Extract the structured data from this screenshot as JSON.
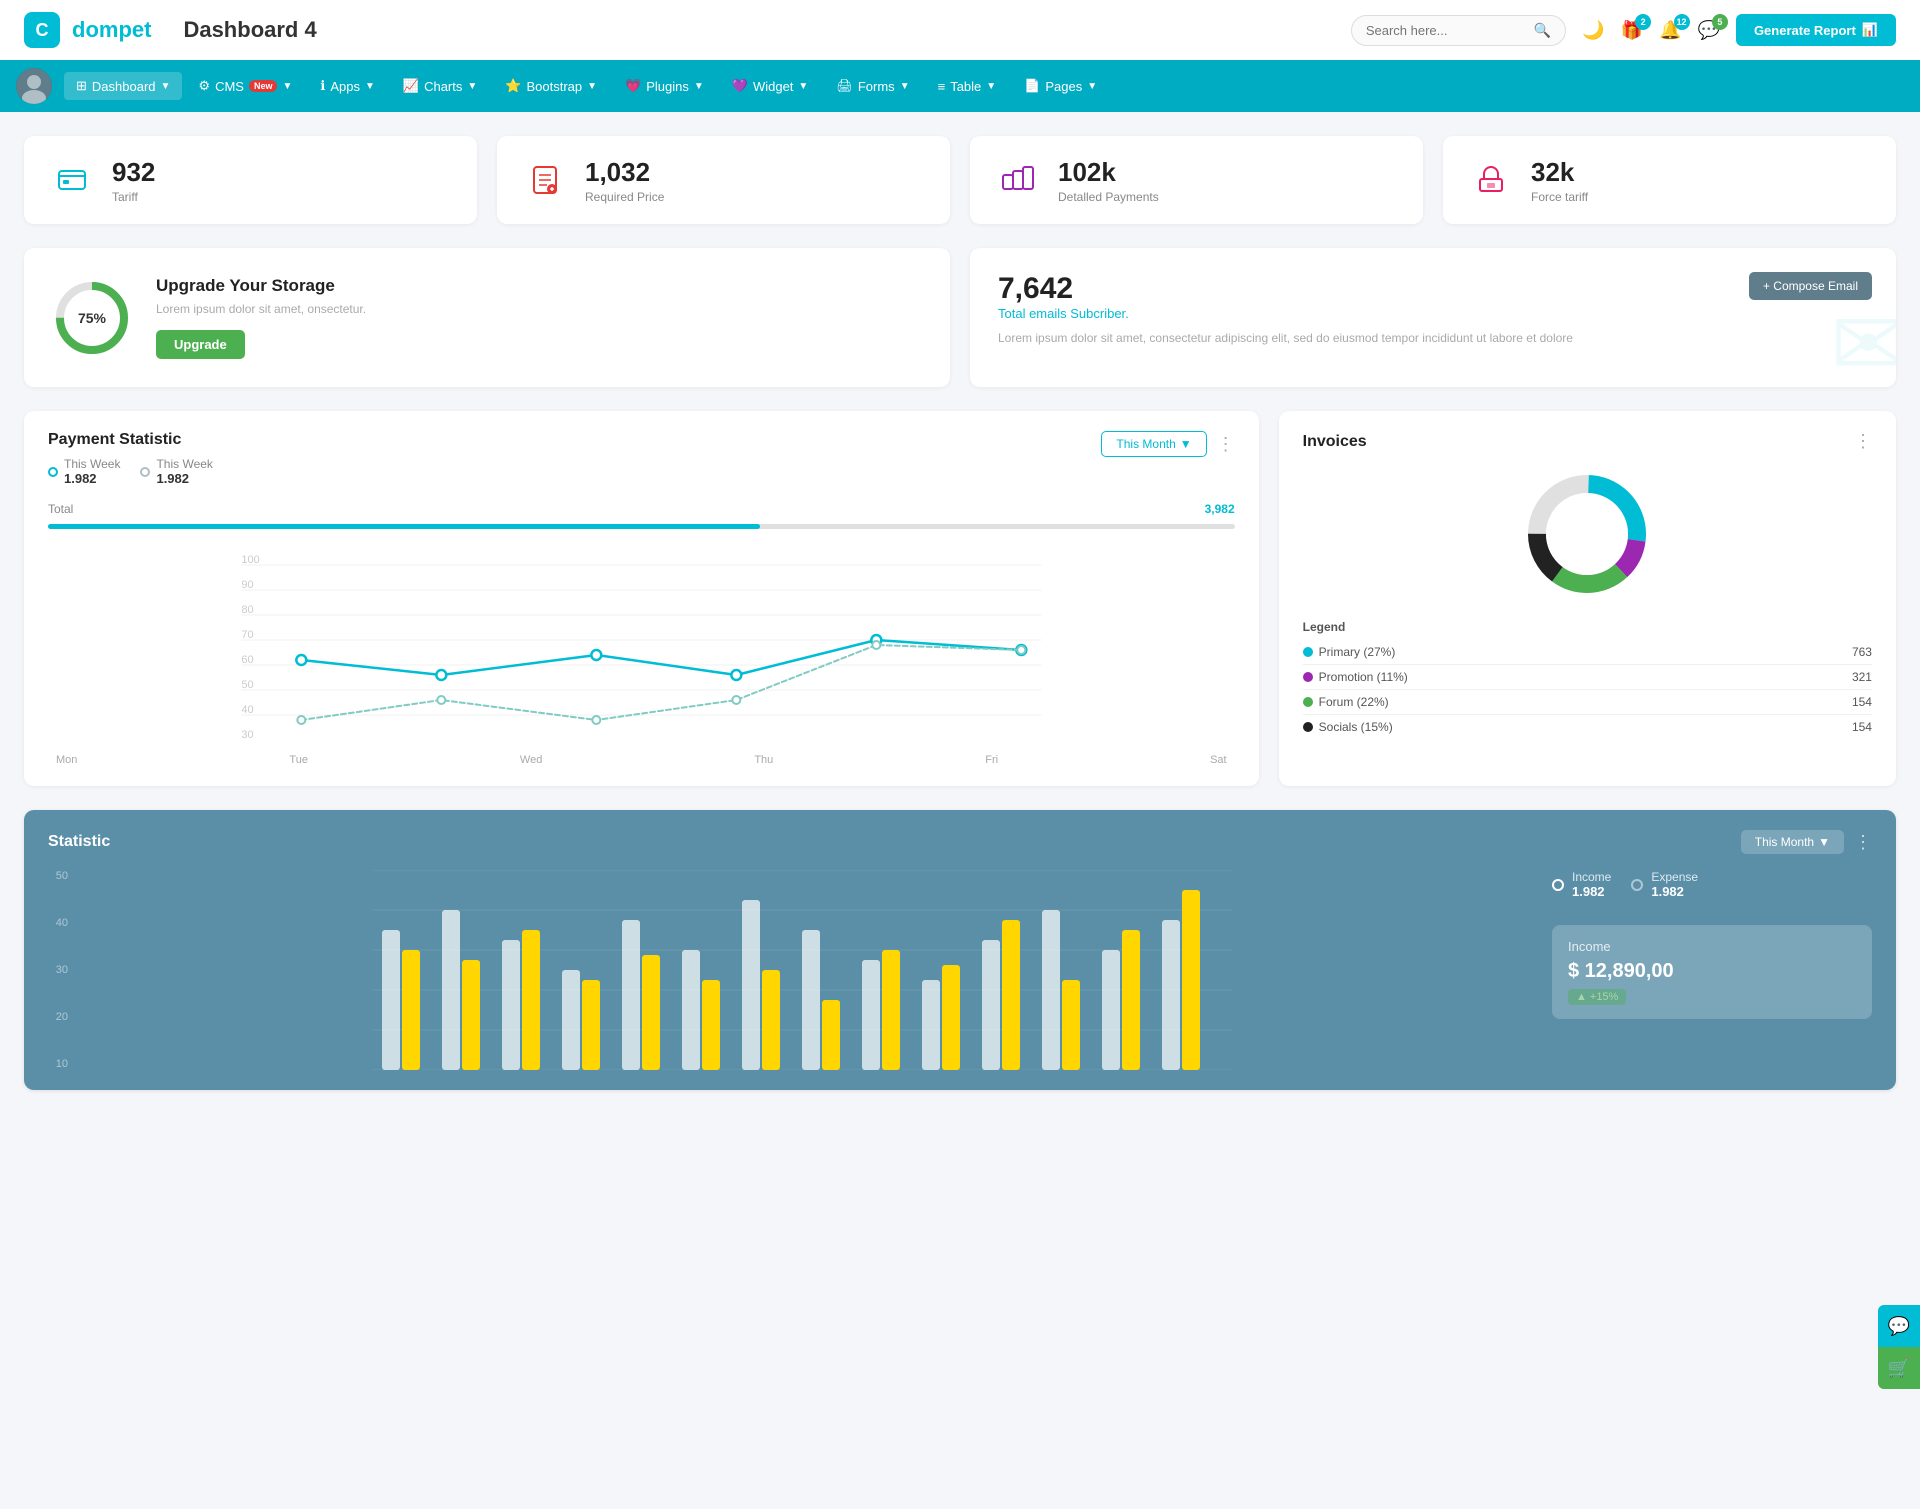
{
  "header": {
    "logo_icon": "C",
    "logo_text": "dompet",
    "page_title": "Dashboard 4",
    "search_placeholder": "Search here...",
    "generate_btn_label": "Generate Report",
    "icons": {
      "gift_badge": "2",
      "bell_badge": "12",
      "chat_badge": "5"
    }
  },
  "navbar": {
    "items": [
      {
        "id": "dashboard",
        "label": "Dashboard",
        "icon": "⊞",
        "active": true,
        "has_arrow": true
      },
      {
        "id": "cms",
        "label": "CMS",
        "icon": "⚙",
        "active": false,
        "has_arrow": true,
        "badge": "New"
      },
      {
        "id": "apps",
        "label": "Apps",
        "icon": "ℹ",
        "active": false,
        "has_arrow": true
      },
      {
        "id": "charts",
        "label": "Charts",
        "icon": "📈",
        "active": false,
        "has_arrow": true
      },
      {
        "id": "bootstrap",
        "label": "Bootstrap",
        "icon": "⭐",
        "active": false,
        "has_arrow": true
      },
      {
        "id": "plugins",
        "label": "Plugins",
        "icon": "💗",
        "active": false,
        "has_arrow": true
      },
      {
        "id": "widget",
        "label": "Widget",
        "icon": "💜",
        "active": false,
        "has_arrow": true
      },
      {
        "id": "forms",
        "label": "Forms",
        "icon": "🖨",
        "active": false,
        "has_arrow": true
      },
      {
        "id": "table",
        "label": "Table",
        "icon": "≡",
        "active": false,
        "has_arrow": true
      },
      {
        "id": "pages",
        "label": "Pages",
        "icon": "📄",
        "active": false,
        "has_arrow": true
      }
    ]
  },
  "stat_cards": [
    {
      "id": "tariff",
      "value": "932",
      "label": "Tariff",
      "icon": "💼",
      "color": "teal"
    },
    {
      "id": "required_price",
      "value": "1,032",
      "label": "Required Price",
      "icon": "📋",
      "color": "red"
    },
    {
      "id": "detailed_payments",
      "value": "102k",
      "label": "Detalled Payments",
      "icon": "🏪",
      "color": "purple"
    },
    {
      "id": "force_tariff",
      "value": "32k",
      "label": "Force tariff",
      "icon": "🏦",
      "color": "pink"
    }
  ],
  "storage": {
    "percent": "75%",
    "title": "Upgrade Your Storage",
    "description": "Lorem ipsum dolor sit amet, onsectetur.",
    "btn_label": "Upgrade",
    "percent_num": 75
  },
  "email": {
    "count": "7,642",
    "subtitle": "Total emails Subcriber.",
    "description": "Lorem ipsum dolor sit amet, consectetur adipiscing elit, sed do eiusmod tempor incididunt ut labore et dolore",
    "compose_btn": "+ Compose Email"
  },
  "payment_statistic": {
    "title": "Payment Statistic",
    "legend": [
      {
        "label": "This Week",
        "value": "1.982",
        "color": "#00bcd4"
      },
      {
        "label": "This Week",
        "value": "1.982",
        "color": "#b0bec5"
      }
    ],
    "month_btn": "This Month",
    "total_label": "Total",
    "total_value": "3,982",
    "x_labels": [
      "Mon",
      "Tue",
      "Wed",
      "Thu",
      "Fri",
      "Sat"
    ],
    "y_labels": [
      "100",
      "90",
      "80",
      "70",
      "60",
      "50",
      "40",
      "30"
    ],
    "line1": "60,145 70,165 175,130 355,110 490,145 495,145 630,95 765,110",
    "line2": "60,175 70,155 175,160 355,175 490,160 495,160 630,100 765,105"
  },
  "invoices": {
    "title": "Invoices",
    "legend_title": "Legend",
    "items": [
      {
        "label": "Primary (27%)",
        "color": "#00bcd4",
        "value": "763"
      },
      {
        "label": "Promotion (11%)",
        "color": "#9c27b0",
        "value": "321"
      },
      {
        "label": "Forum (22%)",
        "color": "#4caf50",
        "value": "154"
      },
      {
        "label": "Socials (15%)",
        "color": "#222",
        "value": "154"
      }
    ]
  },
  "statistic": {
    "title": "Statistic",
    "month_btn": "This Month",
    "y_labels": [
      "50",
      "40",
      "30",
      "20",
      "10"
    ],
    "income": {
      "label": "Income",
      "value": "1.982"
    },
    "expense": {
      "label": "Expense",
      "value": "1.982"
    },
    "income_panel": {
      "title": "Income",
      "amount": "$ 12,890,00",
      "badge": "+15%"
    }
  },
  "floatbtns": {
    "chat": "💬",
    "shop": "🛒"
  }
}
